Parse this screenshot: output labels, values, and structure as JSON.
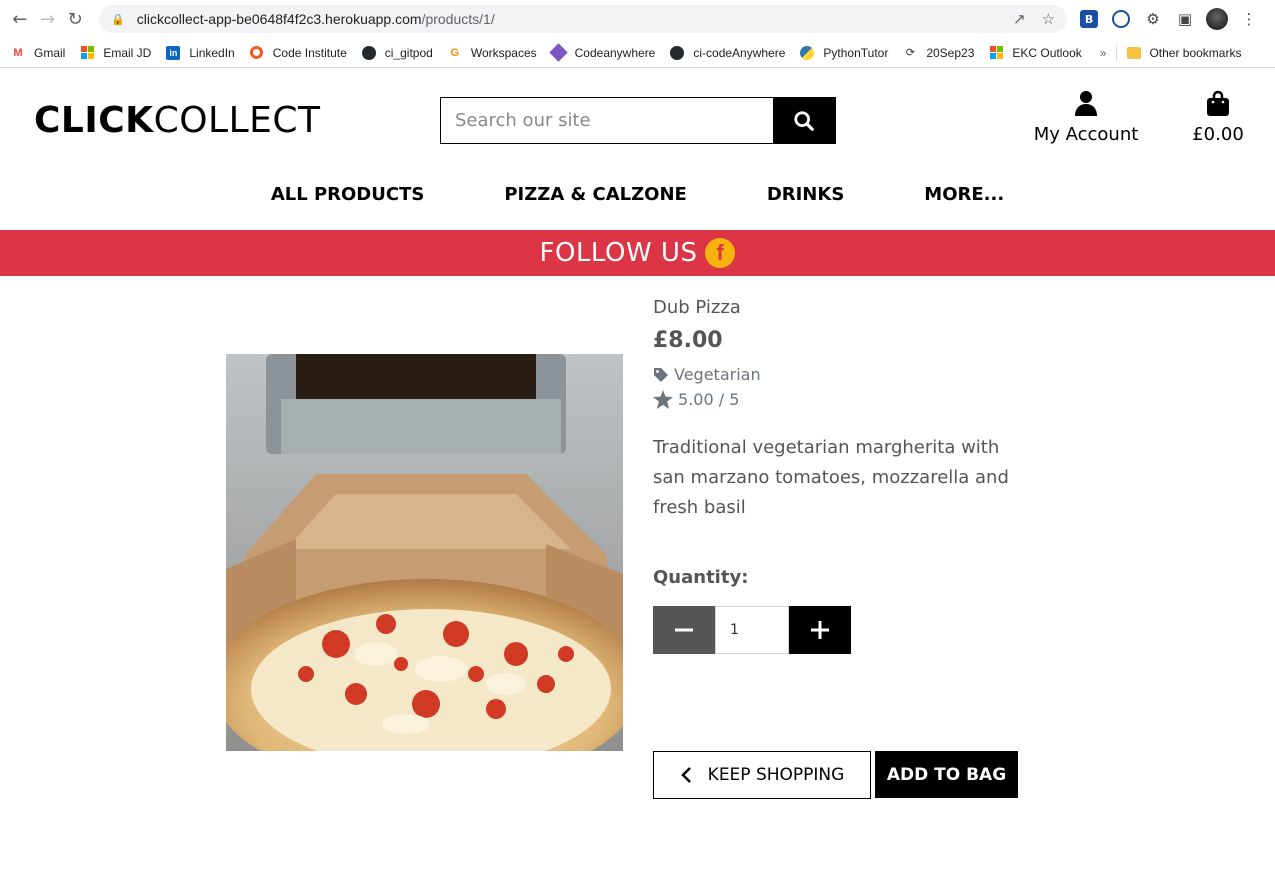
{
  "browser": {
    "url_host": "clickcollect-app-be0648f4f2c3.herokuapp.com",
    "url_path": "/products/1/"
  },
  "bookmarks": [
    {
      "label": "Gmail",
      "icon": "gmail-icon"
    },
    {
      "label": "Email JD",
      "icon": "microsoft-icon"
    },
    {
      "label": "LinkedIn",
      "icon": "linkedin-icon"
    },
    {
      "label": "Code Institute",
      "icon": "code-institute-icon"
    },
    {
      "label": "ci_gitpod",
      "icon": "github-icon"
    },
    {
      "label": "Workspaces",
      "icon": "gitpod-icon"
    },
    {
      "label": "Codeanywhere",
      "icon": "codeanywhere-icon"
    },
    {
      "label": "ci-codeAnywhere",
      "icon": "github-icon"
    },
    {
      "label": "PythonTutor",
      "icon": "python-icon"
    },
    {
      "label": "20Sep23",
      "icon": "swirl-icon"
    },
    {
      "label": "EKC Outlook",
      "icon": "microsoft-icon"
    }
  ],
  "bookmarks_more": "»",
  "bookmarks_other": "Other bookmarks",
  "site": {
    "logo_bold": "CLICK",
    "logo_light": "COLLECT",
    "search_placeholder": "Search our site",
    "account_label": "My Account",
    "bag_total": "£0.00",
    "nav": [
      "ALL PRODUCTS",
      "PIZZA & CALZONE",
      "DRINKS",
      "MORE..."
    ],
    "banner_text": "FOLLOW US",
    "banner_icon": "f"
  },
  "product": {
    "name": "Dub Pizza",
    "price": "£8.00",
    "category": "Vegetarian",
    "rating": "5.00 / 5",
    "description": "Traditional vegetarian margherita with san marzano tomatoes, mozzarella and fresh basil",
    "quantity_label": "Quantity:",
    "quantity_value": "1"
  },
  "actions": {
    "keep_shopping": "KEEP SHOPPING",
    "add_to_bag": "ADD TO BAG"
  },
  "colors": {
    "banner": "#dc3545",
    "facebook_badge": "#f5b30b",
    "primary": "#000000",
    "muted": "#555555"
  }
}
